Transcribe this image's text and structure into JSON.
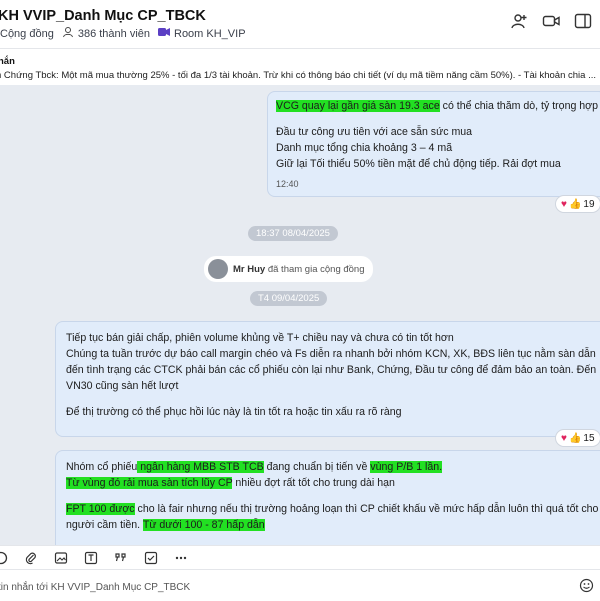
{
  "header": {
    "title": "KH VVIP_Danh Mục CP_TBCK",
    "community": "Cộng đồng",
    "members": "386 thành viên",
    "room": "Room KH_VIP"
  },
  "pinned": {
    "title": "hắn",
    "text": "n Chứng Tbck: Một mã mua thường 25% - tối đa 1/3 tài khoản. Trừ khi có thông báo chi tiết (ví dụ mã tiềm năng cầm 50%). - Tài khoản chia ..."
  },
  "messages": {
    "m1": {
      "line1_hl": "VCG quay lại gần giá sàn 19.3 ace",
      "line1_rest": " có thể chia thăm dò, tỷ trọng hợp",
      "line2": "Đầu tư công ưu tiên với ace sẵn sức mua",
      "line3": "Danh mục tổng chia khoảng 3 – 4 mã",
      "line4": "Giữ lại Tối thiểu 50% tiền mặt để chủ động tiếp. Rải đợt mua",
      "time": "12:40",
      "reactions": "19"
    },
    "date1": "18:37 08/04/2025",
    "join": {
      "name": "Mr Huy",
      "text": "đã tham gia cộng đồng"
    },
    "date2": "T4 09/04/2025",
    "m2": {
      "line1": "Tiếp tục bán giải chấp, phiên volume khủng về T+ chiều nay và chưa có tin tốt hơn",
      "line2": "Chúng ta tuần trước dự báo call margin chéo và Fs diễn ra nhanh bởi nhóm KCN, XK, BĐS liên tục nằm sàn dẫn",
      "line3": "đến tình trạng các CTCK phải bán các cổ phiếu còn lại như Bank, Chứng, Đầu tư công để đảm bảo an toàn. Đến",
      "line4": "VN30 cũng sàn hết lượt",
      "line5": "Để thị trường có thể phục hồi lúc này là tin tốt ra hoặc tin xấu ra rõ ràng",
      "reactions": "15"
    },
    "m3": {
      "l1a": "Nhóm cổ phiếu",
      "l1b": " ngân hàng MBB STB TCB",
      "l1c": " đang chuẩn bị tiến về ",
      "l1d": "vùng P/B 1 lần.",
      "l2a": "Từ vùng đó rải mua sàn tích lũy CP",
      "l2b": " nhiều đợt rất tốt cho trung dài hạn",
      "l3a": "FPT 100 được",
      "l3b": " cho là fair nhưng nếu thị trường hoảng loạn thì CP chiết khấu về mức hấp dẫn luôn thì quá tốt cho",
      "l4a": "người cầm tiền. ",
      "l4b": "Từ dưới 100 - 87 hấp dẫn"
    }
  },
  "input": {
    "placeholder": "tin nhắn tới KH VVIP_Danh Mục CP_TBCK"
  }
}
